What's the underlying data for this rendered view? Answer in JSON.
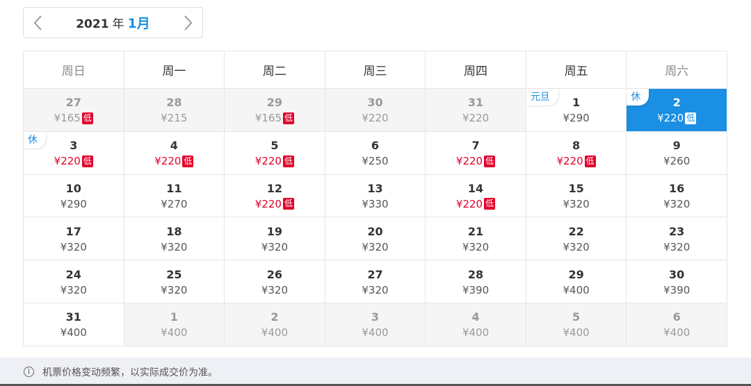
{
  "header": {
    "year": "2021",
    "year_suffix": "年",
    "month": "1月",
    "prev_icon": "chevron-left-icon",
    "next_icon": "chevron-right-icon"
  },
  "weekdays": [
    "周日",
    "周一",
    "周二",
    "周三",
    "周四",
    "周五",
    "周六"
  ],
  "low_label": "低",
  "accent_color": "#1a8fe3",
  "low_color": "#e0002a",
  "weeks": [
    [
      {
        "day": "27",
        "price": "¥165",
        "low": true,
        "other": true
      },
      {
        "day": "28",
        "price": "¥215",
        "other": true
      },
      {
        "day": "29",
        "price": "¥165",
        "low": true,
        "other": true
      },
      {
        "day": "30",
        "price": "¥220",
        "other": true
      },
      {
        "day": "31",
        "price": "¥220",
        "other": true
      },
      {
        "day": "1",
        "price": "¥290",
        "tag": "元旦"
      },
      {
        "day": "2",
        "price": "¥220",
        "low": true,
        "tag": "休",
        "selected": true
      }
    ],
    [
      {
        "day": "3",
        "price": "¥220",
        "low": true,
        "tag": "休"
      },
      {
        "day": "4",
        "price": "¥220",
        "low": true
      },
      {
        "day": "5",
        "price": "¥220",
        "low": true
      },
      {
        "day": "6",
        "price": "¥250"
      },
      {
        "day": "7",
        "price": "¥220",
        "low": true
      },
      {
        "day": "8",
        "price": "¥220",
        "low": true
      },
      {
        "day": "9",
        "price": "¥260"
      }
    ],
    [
      {
        "day": "10",
        "price": "¥290"
      },
      {
        "day": "11",
        "price": "¥270"
      },
      {
        "day": "12",
        "price": "¥220",
        "low": true
      },
      {
        "day": "13",
        "price": "¥330"
      },
      {
        "day": "14",
        "price": "¥220",
        "low": true
      },
      {
        "day": "15",
        "price": "¥320"
      },
      {
        "day": "16",
        "price": "¥320"
      }
    ],
    [
      {
        "day": "17",
        "price": "¥320"
      },
      {
        "day": "18",
        "price": "¥320"
      },
      {
        "day": "19",
        "price": "¥320"
      },
      {
        "day": "20",
        "price": "¥320"
      },
      {
        "day": "21",
        "price": "¥320"
      },
      {
        "day": "22",
        "price": "¥320"
      },
      {
        "day": "23",
        "price": "¥320"
      }
    ],
    [
      {
        "day": "24",
        "price": "¥320"
      },
      {
        "day": "25",
        "price": "¥320"
      },
      {
        "day": "26",
        "price": "¥320"
      },
      {
        "day": "27",
        "price": "¥320"
      },
      {
        "day": "28",
        "price": "¥390"
      },
      {
        "day": "29",
        "price": "¥400"
      },
      {
        "day": "30",
        "price": "¥390"
      }
    ],
    [
      {
        "day": "31",
        "price": "¥400"
      },
      {
        "day": "1",
        "price": "¥400",
        "other": true
      },
      {
        "day": "2",
        "price": "¥400",
        "other": true
      },
      {
        "day": "3",
        "price": "¥400",
        "other": true
      },
      {
        "day": "4",
        "price": "¥400",
        "other": true
      },
      {
        "day": "5",
        "price": "¥400",
        "other": true
      },
      {
        "day": "6",
        "price": "¥400",
        "other": true
      }
    ]
  ],
  "footer": {
    "icon": "info-icon",
    "icon_glyph": "i",
    "text": "机票价格变动频繁，以实际成交价为准。"
  }
}
